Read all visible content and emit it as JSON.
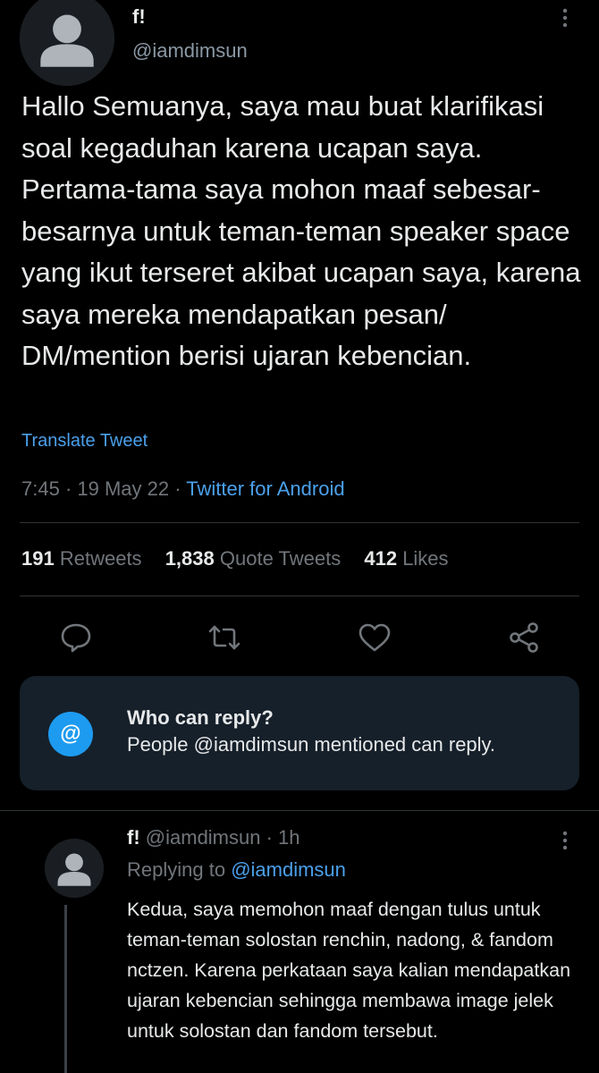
{
  "tweet": {
    "author_name": "f!",
    "author_handle": "@iamdimsun",
    "text": "Hallo Semuanya, saya mau buat klarifikasi soal kegaduhan karena ucapan saya. Pertama-tama saya mohon maaf sebesar-besarnya untuk teman-teman speaker space yang ikut terseret akibat ucapan saya, karena saya mereka mendapatkan pesan/ DM/mention berisi ujaran kebencian.",
    "translate_label": "Translate Tweet",
    "time": "7:45",
    "sep1": " · ",
    "date": "19 May 22",
    "sep2": " · ",
    "source": "Twitter for Android"
  },
  "stats": {
    "retweets_count": "191",
    "retweets_label": "Retweets",
    "quotes_count": "1,838",
    "quotes_label": "Quote Tweets",
    "likes_count": "412",
    "likes_label": "Likes"
  },
  "actions": {
    "icons": [
      "reply-icon",
      "retweet-icon",
      "like-icon",
      "share-icon"
    ]
  },
  "who_can_reply": {
    "icon_glyph": "@",
    "title": "Who can reply?",
    "description": "People @iamdimsun mentioned can reply."
  },
  "reply": {
    "author_name": "f!",
    "author_handle": "@iamdimsun",
    "separator": " · ",
    "age": "1h",
    "replying_prefix": "Replying to",
    "replying_to": "@iamdimsun",
    "text": "Kedua, saya memohon maaf dengan tulus untuk teman-teman solostan renchin, nadong, & fandom nctzen. Karena perkataan saya kalian mendapatkan ujaran kebencian sehingga membawa image jelek untuk solostan dan fandom tersebut."
  },
  "colors": {
    "background": "#000000",
    "text": "#e7e9ea",
    "secondary": "#71767b",
    "link": "#4ba0eb",
    "accent": "#1d9bf0",
    "card": "#16202a"
  }
}
